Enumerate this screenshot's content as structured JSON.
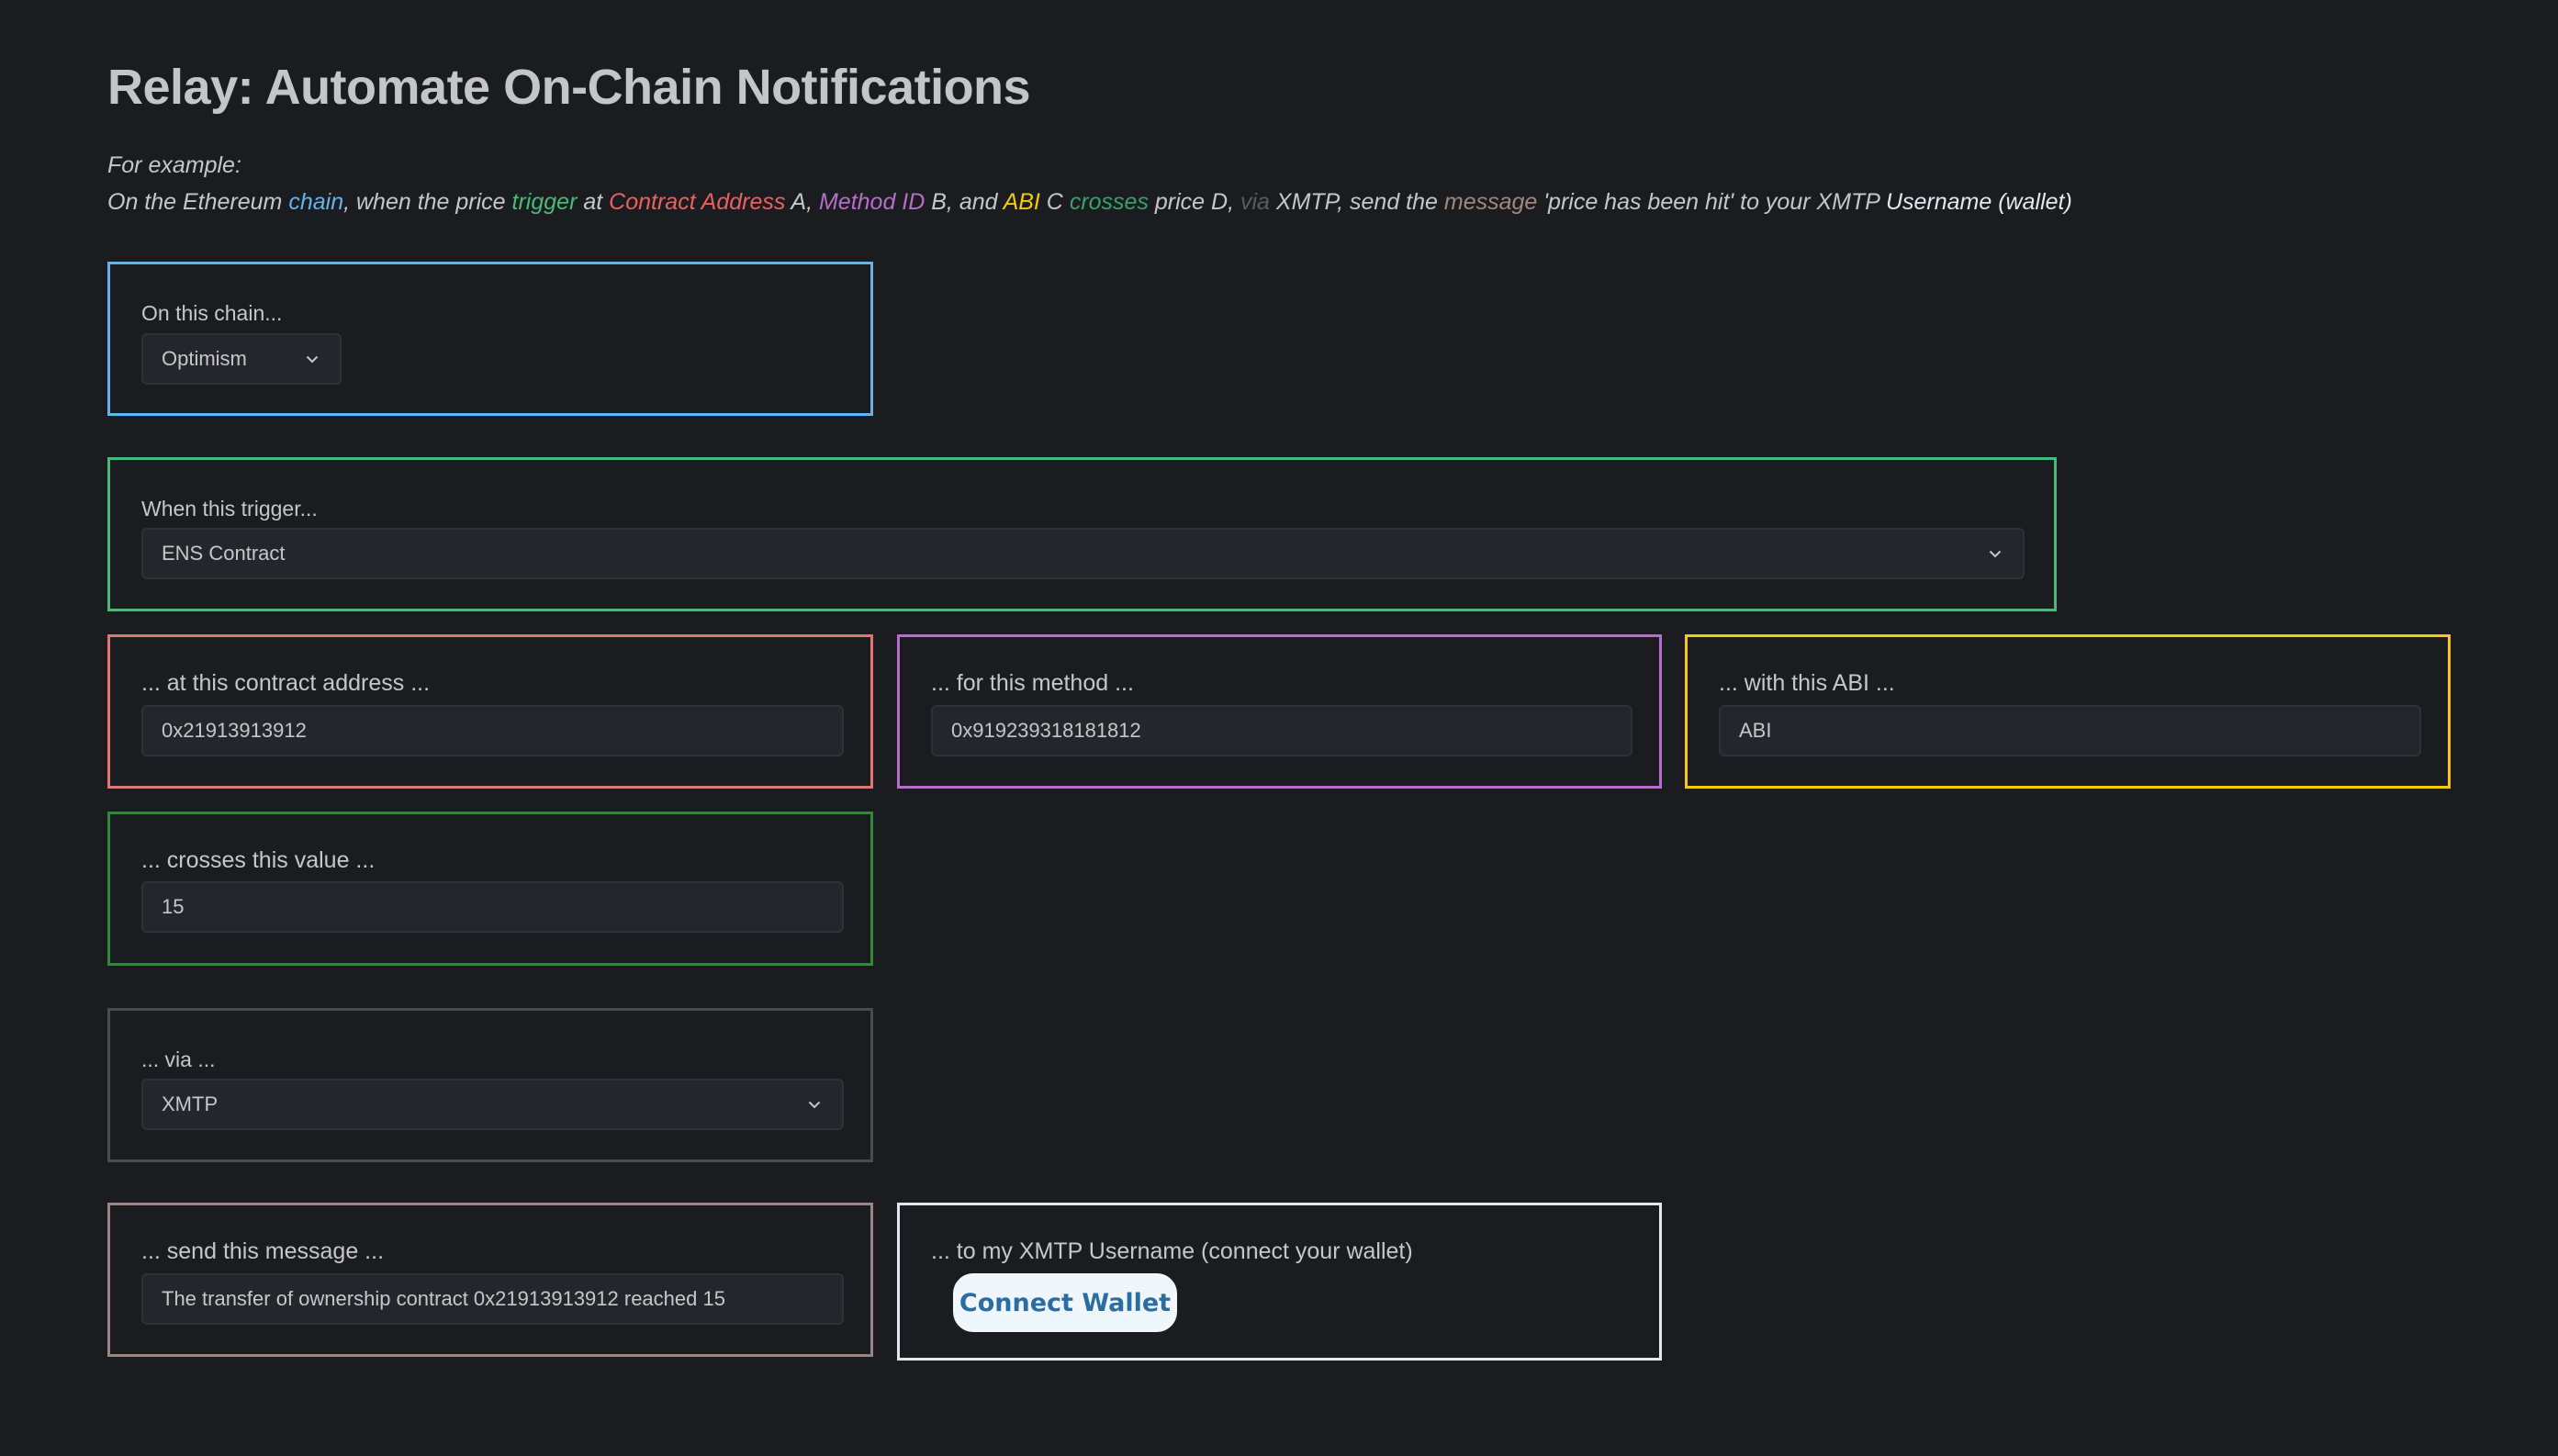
{
  "page": {
    "title": "Relay: Automate On-Chain Notifications",
    "example_label": "For example:",
    "example_sentence": [
      {
        "text": "On the Ethereum ",
        "role": "plain"
      },
      {
        "text": "chain",
        "role": "chain"
      },
      {
        "text": ", when the price ",
        "role": "plain"
      },
      {
        "text": "trigger",
        "role": "trigger"
      },
      {
        "text": " at ",
        "role": "plain"
      },
      {
        "text": "Contract Address",
        "role": "address"
      },
      {
        "text": " A, ",
        "role": "plain"
      },
      {
        "text": "Method ID",
        "role": "method"
      },
      {
        "text": " B, and ",
        "role": "plain"
      },
      {
        "text": "ABI",
        "role": "abi"
      },
      {
        "text": " C ",
        "role": "plain"
      },
      {
        "text": "crosses",
        "role": "crosses"
      },
      {
        "text": " price D, ",
        "role": "plain"
      },
      {
        "text": "via",
        "role": "via"
      },
      {
        "text": " XMTP, send the ",
        "role": "plain"
      },
      {
        "text": "message",
        "role": "message"
      },
      {
        "text": " 'price has been hit' to your XMTP ",
        "role": "plain"
      },
      {
        "text": "Username (wallet)",
        "role": "username"
      }
    ]
  },
  "colors": {
    "background": "#1b1c20",
    "chain": "#63b3ed",
    "trigger": "#48bb78",
    "address": "#e57373",
    "method": "#b56fc8",
    "abi": "#f6c90e",
    "crosses": "#2f8a3a",
    "via": "#4a4b50",
    "message": "#9a8580",
    "username": "#e2e8f0",
    "connect_button_bg": "#eff6fc",
    "connect_button_text": "#2b6ca3"
  },
  "form": {
    "chain": {
      "label": "On this chain...",
      "selected": "Optimism",
      "icon": "chevron-down-icon"
    },
    "trigger": {
      "label": "When this trigger...",
      "selected": "ENS Contract",
      "icon": "chevron-down-icon"
    },
    "contract_address": {
      "label": "... at this contract address ...",
      "value": "0x21913913912"
    },
    "method": {
      "label": "... for this method ...",
      "value": "0x919239318181812"
    },
    "abi": {
      "label": "... with this ABI ...",
      "value": "ABI"
    },
    "crosses_value": {
      "label": "... crosses this value ...",
      "value": "15"
    },
    "via": {
      "label": "... via ...",
      "selected": "XMTP",
      "icon": "chevron-down-icon"
    },
    "message": {
      "label": "... send this message ...",
      "value": "The transfer of ownership contract 0x21913913912 reached 15"
    },
    "username": {
      "label": "... to my XMTP Username (connect your wallet)",
      "connect_button": "Connect Wallet"
    }
  }
}
